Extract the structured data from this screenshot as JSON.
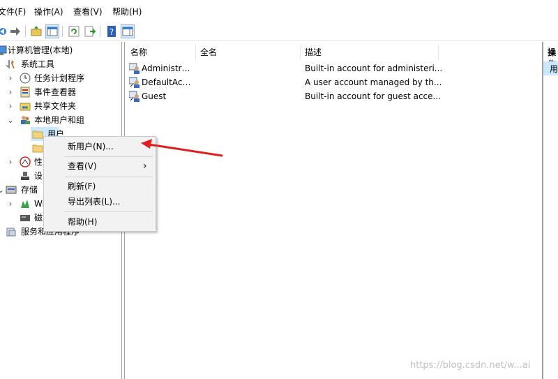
{
  "menubar": {
    "items": [
      "文件(F)",
      "操作(A)",
      "查看(V)",
      "帮助(H)"
    ]
  },
  "toolbar": {
    "buttons": [
      "back-icon",
      "forward-icon",
      "up-folder-icon",
      "show-hide-tree-icon",
      "refresh-icon",
      "export-list-icon",
      "help-icon",
      "properties-icon"
    ]
  },
  "tree": {
    "items": [
      {
        "label": "计算机管理(本地)",
        "icon": "computer-management-icon"
      },
      {
        "label": "系统工具",
        "icon": "system-tools-icon"
      },
      {
        "label": "任务计划程序",
        "icon": "task-scheduler-icon"
      },
      {
        "label": "事件查看器",
        "icon": "event-viewer-icon"
      },
      {
        "label": "共享文件夹",
        "icon": "shared-folders-icon"
      },
      {
        "label": "本地用户和组",
        "icon": "local-users-groups-icon"
      },
      {
        "label": "用户",
        "icon": "folder-icon"
      },
      {
        "label": "性",
        "icon": "performance-icon"
      },
      {
        "label": "设",
        "icon": "device-manager-icon"
      },
      {
        "label": "存储",
        "icon": "storage-icon"
      },
      {
        "label": "Wi",
        "icon": "windows-backup-icon"
      },
      {
        "label": "磁",
        "icon": "disk-management-icon"
      },
      {
        "label": "服务和应用程序",
        "icon": "services-apps-icon"
      }
    ]
  },
  "list": {
    "columns": [
      "名称",
      "全名",
      "描述"
    ],
    "rows": [
      {
        "name": "Administrat...",
        "fullname": "",
        "description": "Built-in account for administeri..."
      },
      {
        "name": "DefaultAcc...",
        "fullname": "",
        "description": "A user account managed by th..."
      },
      {
        "name": "Guest",
        "fullname": "",
        "description": "Built-in account for guest acce..."
      }
    ]
  },
  "actions": {
    "header": "操作",
    "item": "用"
  },
  "context_menu": {
    "items": [
      "新用户(N)...",
      "查看(V)",
      "刷新(F)",
      "导出列表(L)...",
      "帮助(H)"
    ],
    "submenu_arrow": "›"
  },
  "watermark": "https://blog.csdn.net/w...ai",
  "colors": {
    "arrow": "#e02020",
    "selected": "#cce8ff",
    "folder": "#f5d37a"
  }
}
